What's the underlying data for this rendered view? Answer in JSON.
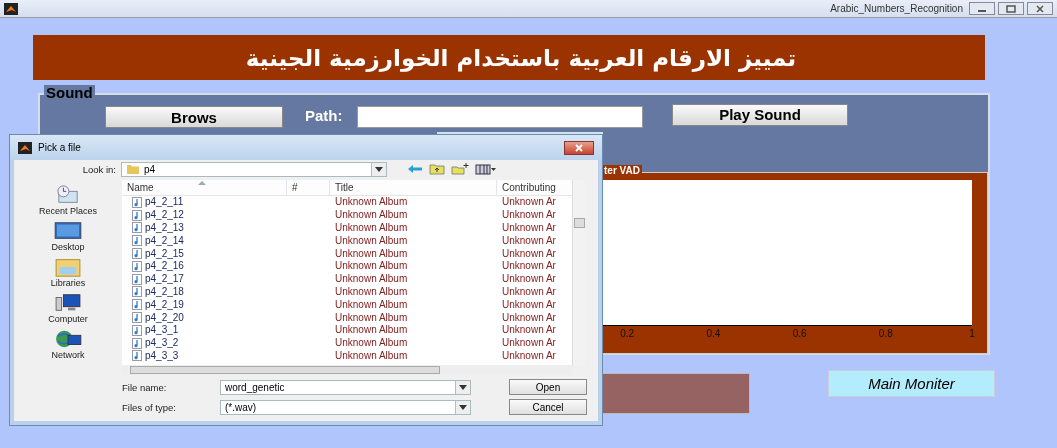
{
  "window": {
    "title": "Arabic_Numbers_Recognition"
  },
  "banner": {
    "title": "تمييز الارقام العربية باستخدام الخوارزمية الجينية"
  },
  "sound_panel": {
    "label": "Sound",
    "browse_button": "Brows",
    "path_label": "Path:",
    "play_button": "Play Sound"
  },
  "chart_panel": {
    "label": "ter VAD",
    "x_tick_labels": [
      "0.2",
      "0.4",
      "0.6",
      "0.8",
      "1"
    ]
  },
  "main_monitor_button": "Main Moniter",
  "dialog": {
    "title": "Pick a file",
    "look_in_label": "Look in:",
    "look_in_value": "p4",
    "places": [
      {
        "kind": "recent",
        "label": "Recent Places"
      },
      {
        "kind": "desktop",
        "label": "Desktop"
      },
      {
        "kind": "libraries",
        "label": "Libraries"
      },
      {
        "kind": "computer",
        "label": "Computer"
      },
      {
        "kind": "network",
        "label": "Network"
      }
    ],
    "columns": [
      "Name",
      "#",
      "Title",
      "Contributing"
    ],
    "files": [
      {
        "name": "p4_2_11",
        "title": "Unknown Album",
        "artist": "Unknown Ar"
      },
      {
        "name": "p4_2_12",
        "title": "Unknown Album",
        "artist": "Unknown Ar"
      },
      {
        "name": "p4_2_13",
        "title": "Unknown Album",
        "artist": "Unknown Ar"
      },
      {
        "name": "p4_2_14",
        "title": "Unknown Album",
        "artist": "Unknown Ar"
      },
      {
        "name": "p4_2_15",
        "title": "Unknown Album",
        "artist": "Unknown Ar"
      },
      {
        "name": "p4_2_16",
        "title": "Unknown Album",
        "artist": "Unknown Ar"
      },
      {
        "name": "p4_2_17",
        "title": "Unknown Album",
        "artist": "Unknown Ar"
      },
      {
        "name": "p4_2_18",
        "title": "Unknown Album",
        "artist": "Unknown Ar"
      },
      {
        "name": "p4_2_19",
        "title": "Unknown Album",
        "artist": "Unknown Ar"
      },
      {
        "name": "p4_2_20",
        "title": "Unknown Album",
        "artist": "Unknown Ar"
      },
      {
        "name": "p4_3_1",
        "title": "Unknown Album",
        "artist": "Unknown Ar"
      },
      {
        "name": "p4_3_2",
        "title": "Unknown Album",
        "artist": "Unknown Ar"
      },
      {
        "name": "p4_3_3",
        "title": "Unknown Album",
        "artist": "Unknown Ar"
      }
    ],
    "file_name_label": "File name:",
    "file_name_value": "word_genetic",
    "file_type_label": "Files of type:",
    "file_type_value": "(*.wav)",
    "open_button": "Open",
    "cancel_button": "Cancel"
  }
}
